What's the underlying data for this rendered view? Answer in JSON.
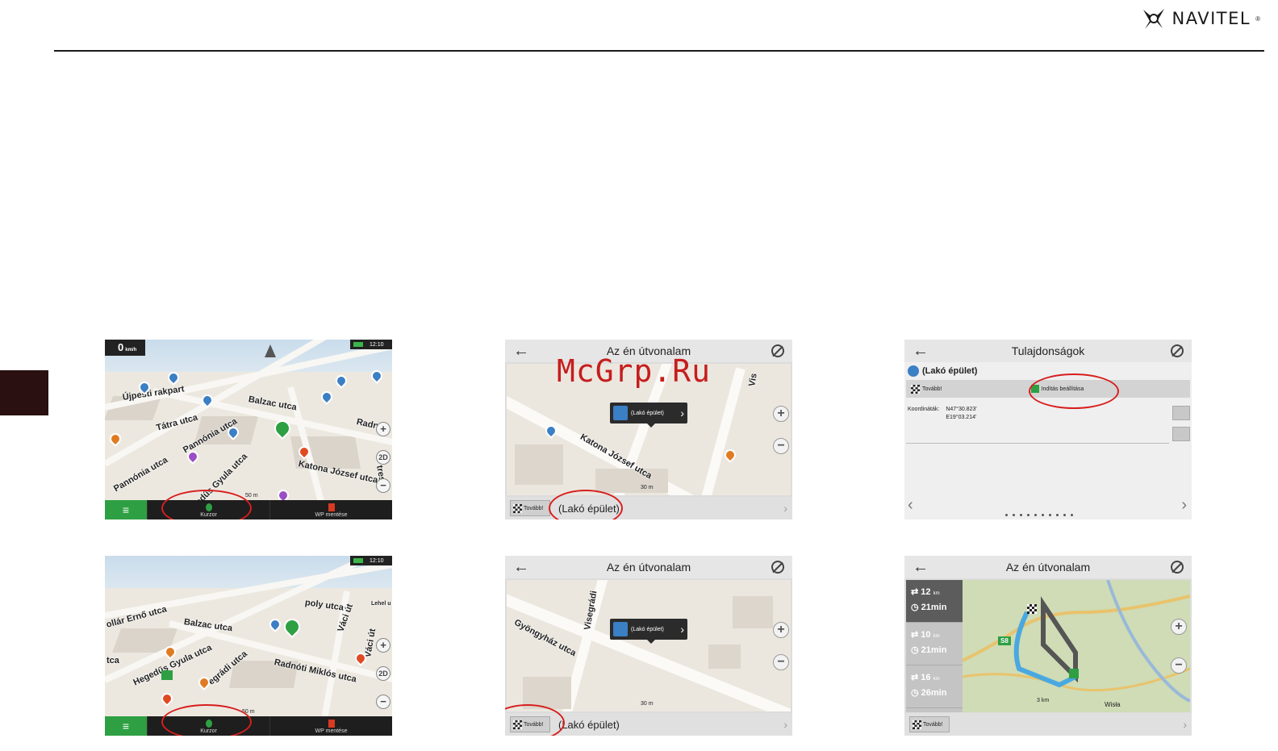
{
  "brand": {
    "name": "NAVITEL",
    "reg": "®"
  },
  "watermark": "McGrp.Ru",
  "panel_map1": {
    "speed": "0",
    "speed_unit": "km/h",
    "time": "12:10",
    "streets": [
      "Újpesti rakpart",
      "Balzac utca",
      "Tátra utca",
      "Pannónia utca",
      "Pannónia utca",
      "Hegedűs Gyula utca",
      "Katona József utca",
      "Radn",
      "tres ut"
    ],
    "scale": "50 m",
    "controls": {
      "plus": "+",
      "mode": "2D",
      "minus": "−"
    },
    "menu": "≡",
    "cursor_label": "Kurzor",
    "save_label": "WP mentése"
  },
  "panel_map2": {
    "time": "12:10",
    "streets": [
      "poly utca",
      "Balzac utca",
      "ollár Ernő utca",
      "Hegedűs Gyula utca",
      "Radnóti Miklós utca",
      "egrádi utca",
      "Váci út",
      "Lehel u",
      "Váci út",
      "tca"
    ],
    "scale": "50 m",
    "controls": {
      "plus": "+",
      "mode": "2D",
      "minus": "−"
    },
    "menu": "≡",
    "cursor_label": "Kurzor",
    "save_label": "WP mentése"
  },
  "panel_route1": {
    "title": "Az én útvonalam",
    "popup": "(Lakó épület)",
    "streets": [
      "Katona József utca",
      "Vis"
    ],
    "scale": "30 m",
    "tovabb": "Tovább!",
    "destination": "(Lakó épület)"
  },
  "panel_route2": {
    "title": "Az én útvonalam",
    "popup": "(Lakó épület)",
    "streets": [
      "Gyöngyház utca",
      "Visegrádi"
    ],
    "scale": "30 m",
    "tovabb": "Tovább!",
    "destination": "(Lakó épület)"
  },
  "panel_props": {
    "title": "Tulajdonságok",
    "name": "(Lakó épület)",
    "tovabb": "Tovább!",
    "start_settings": "Indítás beállítása",
    "coords_label": "Koordináták:",
    "coords_lat": "N47°30.823'",
    "coords_lon": "E19°03.214'"
  },
  "panel_routes": {
    "title": "Az én útvonalam",
    "routes": [
      {
        "dist": "12",
        "unit": "km",
        "time": "21min"
      },
      {
        "dist": "10",
        "unit": "km",
        "time": "21min"
      },
      {
        "dist": "16",
        "unit": "km",
        "time": "26min"
      }
    ],
    "road_badge": "S8",
    "river": "Wisła",
    "scale": "3 km",
    "tovabb": "Tovább!"
  },
  "colors": {
    "highlight": "#d81e1e",
    "accent_green": "#2ea043",
    "watermark": "#c61d1d"
  }
}
